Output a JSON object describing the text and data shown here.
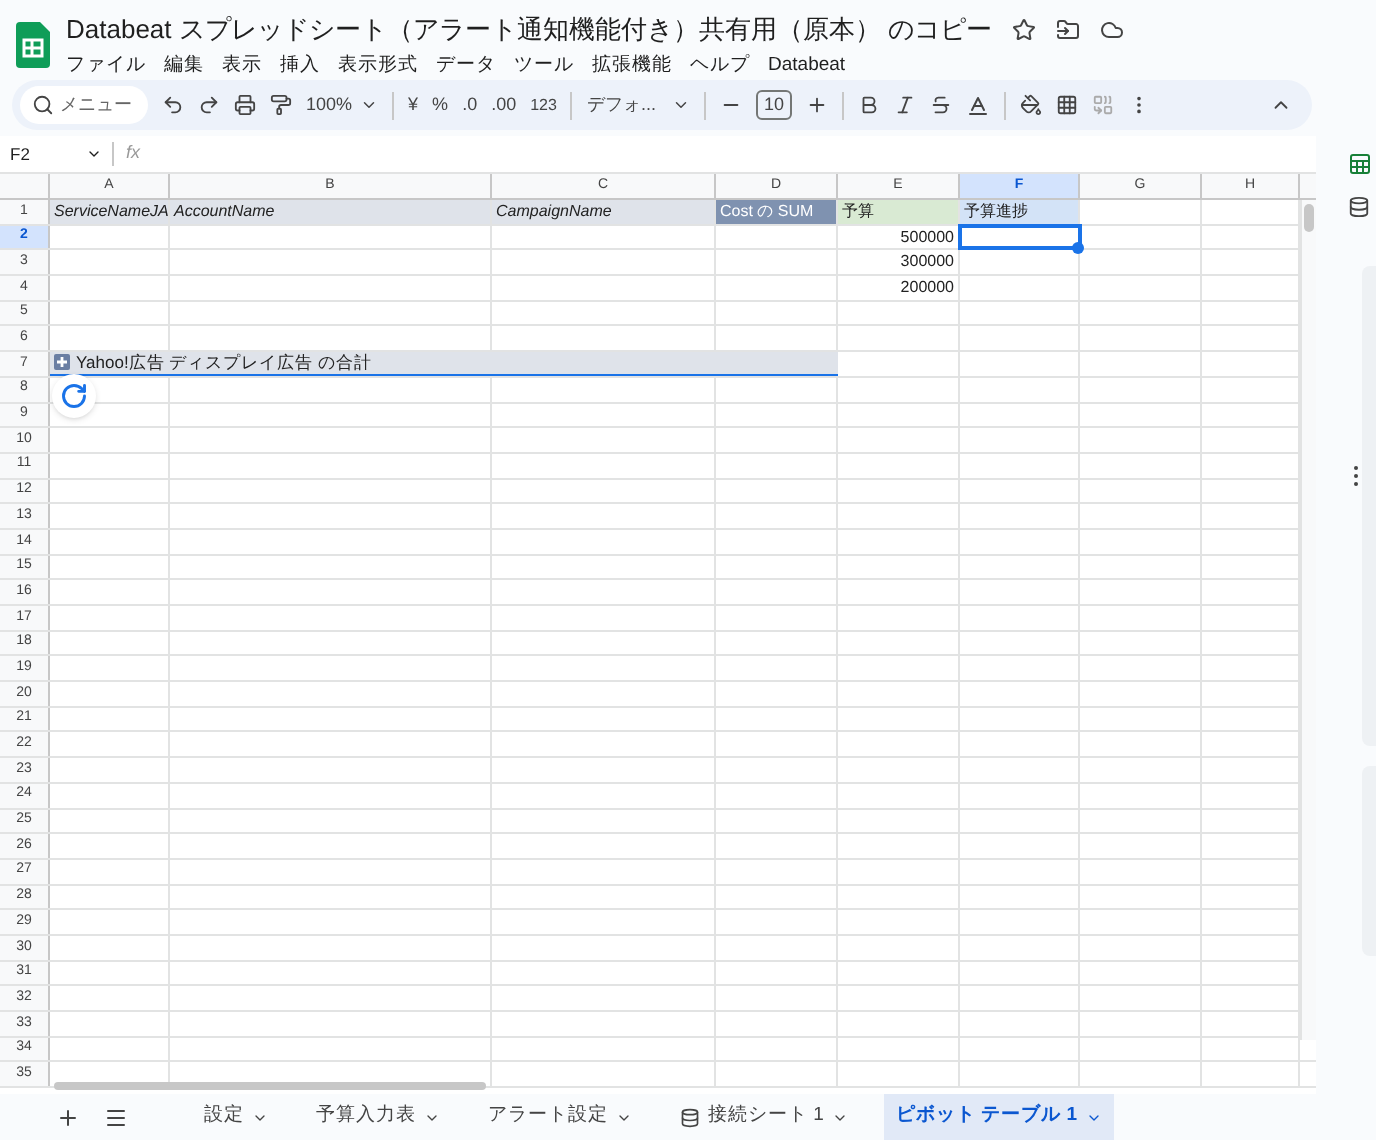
{
  "title": "Databeat スプレッドシート（アラート通知機能付き）共有用（原本） のコピー",
  "menus": [
    "ファイル",
    "編集",
    "表示",
    "挿入",
    "表示形式",
    "データ",
    "ツール",
    "拡張機能",
    "ヘルプ",
    "Databeat"
  ],
  "toolbar": {
    "search_placeholder": "メニュー",
    "zoom": "100%",
    "currency": "¥",
    "percent": "%",
    "decrease_decimal": ".0",
    "increase_decimal": ".00",
    "number_format": "123",
    "font": "デフォ...",
    "font_size": "10"
  },
  "name_box": "F2",
  "formula_label": "fx",
  "columns": [
    {
      "label": "A",
      "selected": false
    },
    {
      "label": "B",
      "selected": false
    },
    {
      "label": "C",
      "selected": false
    },
    {
      "label": "D",
      "selected": false
    },
    {
      "label": "E",
      "selected": false
    },
    {
      "label": "F",
      "selected": true
    },
    {
      "label": "G",
      "selected": false
    },
    {
      "label": "H",
      "selected": false
    }
  ],
  "rows": [
    {
      "label": "1",
      "selected": false,
      "cells": [
        {
          "kind": "field",
          "text": "ServiceNameJA"
        },
        {
          "kind": "field",
          "text": "AccountName"
        },
        {
          "kind": "field",
          "text": "CampaignName"
        },
        {
          "kind": "measure",
          "text": "Cost の SUM"
        },
        {
          "kind": "values",
          "text": "予算"
        },
        {
          "kind": "calc",
          "text": "予算進捗"
        }
      ]
    },
    {
      "label": "2",
      "selected": true,
      "cells": [
        {
          "kind": "empty"
        },
        {
          "kind": "empty"
        },
        {
          "kind": "empty"
        },
        {
          "kind": "empty"
        },
        {
          "kind": "number",
          "text": "500000"
        },
        {
          "kind": "empty",
          "selected": true
        }
      ]
    },
    {
      "label": "3",
      "selected": false,
      "cells": [
        {
          "kind": "empty"
        },
        {
          "kind": "empty"
        },
        {
          "kind": "empty"
        },
        {
          "kind": "empty"
        },
        {
          "kind": "number",
          "text": "300000"
        }
      ]
    },
    {
      "label": "4",
      "selected": false,
      "cells": [
        {
          "kind": "empty"
        },
        {
          "kind": "empty"
        },
        {
          "kind": "empty"
        },
        {
          "kind": "empty"
        },
        {
          "kind": "number",
          "text": "200000"
        }
      ]
    },
    {
      "label": "5",
      "selected": false
    },
    {
      "label": "6",
      "selected": false
    },
    {
      "label": "7",
      "selected": false,
      "group": "Yahoo!広告 ディスプレイ広告 の合計"
    },
    {
      "label": "8",
      "selected": false
    },
    {
      "label": "9",
      "selected": false
    },
    {
      "label": "10",
      "selected": false
    },
    {
      "label": "11",
      "selected": false
    },
    {
      "label": "12",
      "selected": false
    },
    {
      "label": "13",
      "selected": false
    },
    {
      "label": "14",
      "selected": false
    },
    {
      "label": "15",
      "selected": false
    },
    {
      "label": "16",
      "selected": false
    },
    {
      "label": "17",
      "selected": false
    },
    {
      "label": "18",
      "selected": false
    },
    {
      "label": "19",
      "selected": false
    },
    {
      "label": "20",
      "selected": false
    },
    {
      "label": "21",
      "selected": false
    },
    {
      "label": "22",
      "selected": false
    },
    {
      "label": "23",
      "selected": false
    },
    {
      "label": "24",
      "selected": false
    },
    {
      "label": "25",
      "selected": false
    },
    {
      "label": "26",
      "selected": false
    },
    {
      "label": "27",
      "selected": false
    },
    {
      "label": "28",
      "selected": false
    },
    {
      "label": "29",
      "selected": false
    },
    {
      "label": "30",
      "selected": false
    },
    {
      "label": "31",
      "selected": false
    },
    {
      "label": "32",
      "selected": false
    },
    {
      "label": "33",
      "selected": false
    },
    {
      "label": "34",
      "selected": false
    },
    {
      "label": "35",
      "selected": false
    }
  ],
  "sheet_tabs": [
    {
      "label": "設定",
      "kind": "sheet",
      "selected": false
    },
    {
      "label": "予算入力表",
      "kind": "sheet",
      "selected": false
    },
    {
      "label": "アラート設定",
      "kind": "sheet",
      "selected": false
    },
    {
      "label": "接続シート 1",
      "kind": "connected",
      "selected": false
    },
    {
      "label": "ピボット テーブル 1",
      "kind": "sheet",
      "selected": true
    }
  ]
}
